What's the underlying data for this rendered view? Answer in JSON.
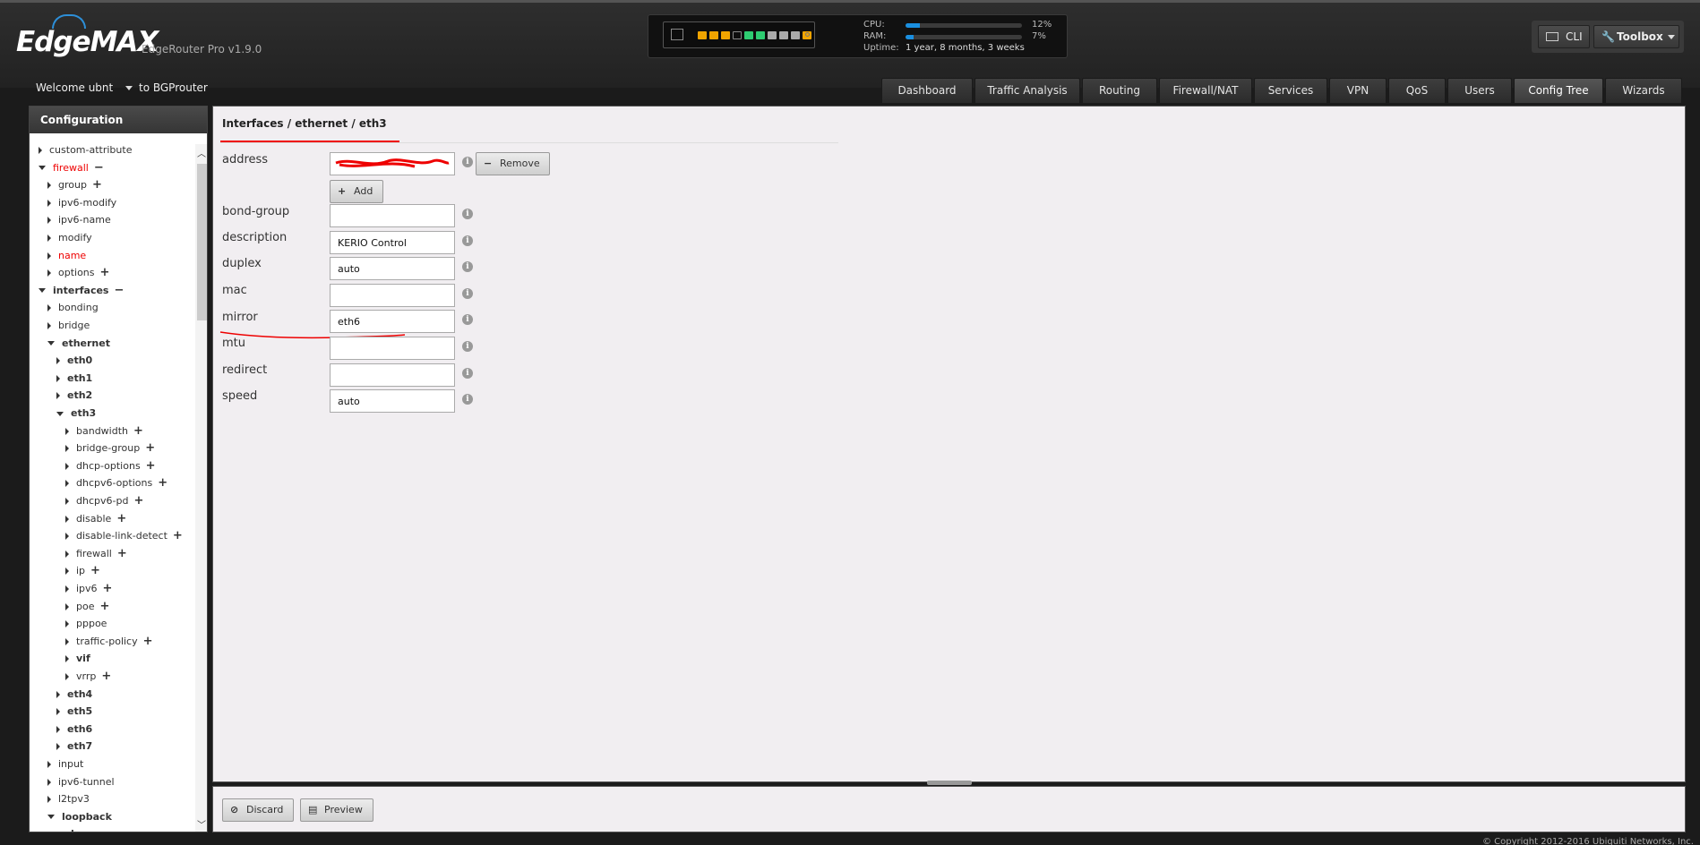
{
  "header": {
    "logo_text": "EdgeMAX",
    "product": "EdgeRouter Pro v1.9.0",
    "cpu_label": "CPU:",
    "cpu_pct": "12%",
    "cpu_value": 12,
    "ram_label": "RAM:",
    "ram_pct": "7%",
    "ram_value": 7,
    "uptime_label": "Uptime:",
    "uptime_value": "1 year, 8 months, 3 weeks",
    "cli_label": "CLI",
    "toolbox_label": "Toolbox",
    "welcome": "Welcome ubnt",
    "host": "to BGProuter",
    "port_colors": [
      "#f0a400",
      "#f0a400",
      "#f0a400",
      "#2a2a2a",
      "#2ecc71",
      "#2ecc71",
      "#aaaaaa",
      "#aaaaaa",
      "#aaaaaa",
      "#f0a400"
    ]
  },
  "tabs": [
    "Dashboard",
    "Traffic Analysis",
    "Routing",
    "Firewall/NAT",
    "Services",
    "VPN",
    "QoS",
    "Users",
    "Config Tree",
    "Wizards"
  ],
  "active_tab": "Config Tree",
  "sidebar": {
    "title": "Configuration",
    "items": [
      {
        "label": "custom-attribute",
        "depth": 0,
        "open": false,
        "plus": false,
        "minus": false,
        "red": false,
        "bold": false
      },
      {
        "label": "firewall",
        "depth": 0,
        "open": true,
        "plus": false,
        "minus": true,
        "red": true,
        "bold": false
      },
      {
        "label": "group",
        "depth": 1,
        "open": false,
        "plus": true,
        "minus": false,
        "red": false,
        "bold": false
      },
      {
        "label": "ipv6-modify",
        "depth": 1,
        "open": false,
        "plus": false,
        "minus": false,
        "red": false,
        "bold": false
      },
      {
        "label": "ipv6-name",
        "depth": 1,
        "open": false,
        "plus": false,
        "minus": false,
        "red": false,
        "bold": false
      },
      {
        "label": "modify",
        "depth": 1,
        "open": false,
        "plus": false,
        "minus": false,
        "red": false,
        "bold": false
      },
      {
        "label": "name",
        "depth": 1,
        "open": false,
        "plus": false,
        "minus": false,
        "red": true,
        "bold": false
      },
      {
        "label": "options",
        "depth": 1,
        "open": false,
        "plus": true,
        "minus": false,
        "red": false,
        "bold": false
      },
      {
        "label": "interfaces",
        "depth": 0,
        "open": true,
        "plus": false,
        "minus": true,
        "red": false,
        "bold": true
      },
      {
        "label": "bonding",
        "depth": 1,
        "open": false,
        "plus": false,
        "minus": false,
        "red": false,
        "bold": false
      },
      {
        "label": "bridge",
        "depth": 1,
        "open": false,
        "plus": false,
        "minus": false,
        "red": false,
        "bold": false
      },
      {
        "label": "ethernet",
        "depth": 1,
        "open": true,
        "plus": false,
        "minus": false,
        "red": false,
        "bold": true
      },
      {
        "label": "eth0",
        "depth": 2,
        "open": false,
        "plus": false,
        "minus": false,
        "red": false,
        "bold": true
      },
      {
        "label": "eth1",
        "depth": 2,
        "open": false,
        "plus": false,
        "minus": false,
        "red": false,
        "bold": true
      },
      {
        "label": "eth2",
        "depth": 2,
        "open": false,
        "plus": false,
        "minus": false,
        "red": false,
        "bold": true
      },
      {
        "label": "eth3",
        "depth": 2,
        "open": true,
        "plus": false,
        "minus": false,
        "red": false,
        "bold": true
      },
      {
        "label": "bandwidth",
        "depth": 3,
        "open": false,
        "plus": true,
        "minus": false,
        "red": false,
        "bold": false
      },
      {
        "label": "bridge-group",
        "depth": 3,
        "open": false,
        "plus": true,
        "minus": false,
        "red": false,
        "bold": false
      },
      {
        "label": "dhcp-options",
        "depth": 3,
        "open": false,
        "plus": true,
        "minus": false,
        "red": false,
        "bold": false
      },
      {
        "label": "dhcpv6-options",
        "depth": 3,
        "open": false,
        "plus": true,
        "minus": false,
        "red": false,
        "bold": false
      },
      {
        "label": "dhcpv6-pd",
        "depth": 3,
        "open": false,
        "plus": true,
        "minus": false,
        "red": false,
        "bold": false
      },
      {
        "label": "disable",
        "depth": 3,
        "open": false,
        "plus": true,
        "minus": false,
        "red": false,
        "bold": false
      },
      {
        "label": "disable-link-detect",
        "depth": 3,
        "open": false,
        "plus": true,
        "minus": false,
        "red": false,
        "bold": false
      },
      {
        "label": "firewall",
        "depth": 3,
        "open": false,
        "plus": true,
        "minus": false,
        "red": false,
        "bold": false
      },
      {
        "label": "ip",
        "depth": 3,
        "open": false,
        "plus": true,
        "minus": false,
        "red": false,
        "bold": false
      },
      {
        "label": "ipv6",
        "depth": 3,
        "open": false,
        "plus": true,
        "minus": false,
        "red": false,
        "bold": false
      },
      {
        "label": "poe",
        "depth": 3,
        "open": false,
        "plus": true,
        "minus": false,
        "red": false,
        "bold": false
      },
      {
        "label": "pppoe",
        "depth": 3,
        "open": false,
        "plus": false,
        "minus": false,
        "red": false,
        "bold": false
      },
      {
        "label": "traffic-policy",
        "depth": 3,
        "open": false,
        "plus": true,
        "minus": false,
        "red": false,
        "bold": false
      },
      {
        "label": "vif",
        "depth": 3,
        "open": false,
        "plus": false,
        "minus": false,
        "red": false,
        "bold": true
      },
      {
        "label": "vrrp",
        "depth": 3,
        "open": false,
        "plus": true,
        "minus": false,
        "red": false,
        "bold": false
      },
      {
        "label": "eth4",
        "depth": 2,
        "open": false,
        "plus": false,
        "minus": false,
        "red": false,
        "bold": true
      },
      {
        "label": "eth5",
        "depth": 2,
        "open": false,
        "plus": false,
        "minus": false,
        "red": false,
        "bold": true
      },
      {
        "label": "eth6",
        "depth": 2,
        "open": false,
        "plus": false,
        "minus": false,
        "red": false,
        "bold": true
      },
      {
        "label": "eth7",
        "depth": 2,
        "open": false,
        "plus": false,
        "minus": false,
        "red": false,
        "bold": true
      },
      {
        "label": "input",
        "depth": 1,
        "open": false,
        "plus": false,
        "minus": false,
        "red": false,
        "bold": false
      },
      {
        "label": "ipv6-tunnel",
        "depth": 1,
        "open": false,
        "plus": false,
        "minus": false,
        "red": false,
        "bold": false
      },
      {
        "label": "l2tpv3",
        "depth": 1,
        "open": false,
        "plus": false,
        "minus": false,
        "red": false,
        "bold": false
      },
      {
        "label": "loopback",
        "depth": 1,
        "open": true,
        "plus": false,
        "minus": false,
        "red": false,
        "bold": true
      },
      {
        "label": "lo",
        "depth": 2,
        "open": true,
        "plus": false,
        "minus": false,
        "red": false,
        "bold": true
      }
    ]
  },
  "main": {
    "breadcrumb": "Interfaces / ethernet / eth3",
    "remove_label": "Remove",
    "add_label": "Add",
    "fields": [
      {
        "label": "address",
        "value": ""
      },
      {
        "label": "bond-group",
        "value": ""
      },
      {
        "label": "description",
        "value": "KERIO Control"
      },
      {
        "label": "duplex",
        "value": "auto"
      },
      {
        "label": "mac",
        "value": ""
      },
      {
        "label": "mirror",
        "value": "eth6"
      },
      {
        "label": "mtu",
        "value": ""
      },
      {
        "label": "redirect",
        "value": ""
      },
      {
        "label": "speed",
        "value": "auto"
      }
    ]
  },
  "footer": {
    "discard_label": "Discard",
    "preview_label": "Preview",
    "copyright": "© Copyright 2012-2016 Ubiquiti Networks, Inc."
  }
}
